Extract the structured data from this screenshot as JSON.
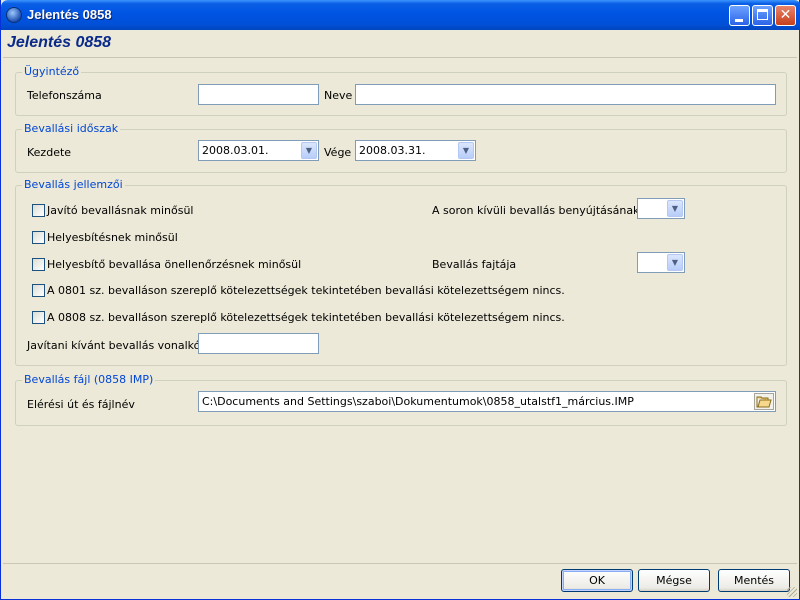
{
  "window": {
    "title": "Jelentés 0858",
    "form_title": "Jelentés 0858",
    "close_glyph": "✕",
    "icon_names": [
      "app-icon",
      "minimize-icon",
      "maximize-icon",
      "close-icon"
    ]
  },
  "ugyintezo": {
    "legend": "Ügyintéző",
    "phone_label": "Telefonszáma",
    "phone_value": "",
    "name_label": "Neve",
    "name_value": ""
  },
  "idoszak": {
    "legend": "Bevallási időszak",
    "start_label": "Kezdete",
    "start_value": "2008.03.01.",
    "end_label": "Vége",
    "end_value": "2008.03.31."
  },
  "jellemzok": {
    "legend": "Bevallás jellemzői",
    "checkboxes": [
      {
        "label": "Javító bevallásnak minősül",
        "checked": false
      },
      {
        "label": "Helyesbítésnek minősül",
        "checked": false
      },
      {
        "label": "Helyesbítő bevallása önellenőrzésnek minősül",
        "checked": false
      },
      {
        "label": "A 0801 sz. bevalláson szereplő kötelezettségek tekintetében bevallási kötelezettségem nincs.",
        "checked": false
      },
      {
        "label": "A 0808 sz. bevalláson szereplő kötelezettségek tekintetében bevallási kötelezettségem nincs.",
        "checked": false
      }
    ],
    "out_of_order_reason_label": "A soron kívüli bevallás benyújtásának oka",
    "out_of_order_reason_value": "",
    "type_label": "Bevallás fajtája",
    "type_value": "",
    "barcode_label": "Javítani kívánt bevallás vonalkódja",
    "barcode_value": ""
  },
  "fajl": {
    "legend": "Bevallás fájl (0858 IMP)",
    "path_label": "Elérési út és fájlnév",
    "path_value": "C:\\Documents and Settings\\szaboi\\Dokumentumok\\0858_utalstf1_március.IMP",
    "browse_icon": "folder-open-icon"
  },
  "buttons": {
    "ok": "OK",
    "cancel": "Mégse",
    "save": "Mentés"
  },
  "colors": {
    "title_bar": "#0054e3",
    "group_legend": "#0046d5",
    "form_title": "#0a2a8a",
    "window_bg": "#ece9d8"
  }
}
